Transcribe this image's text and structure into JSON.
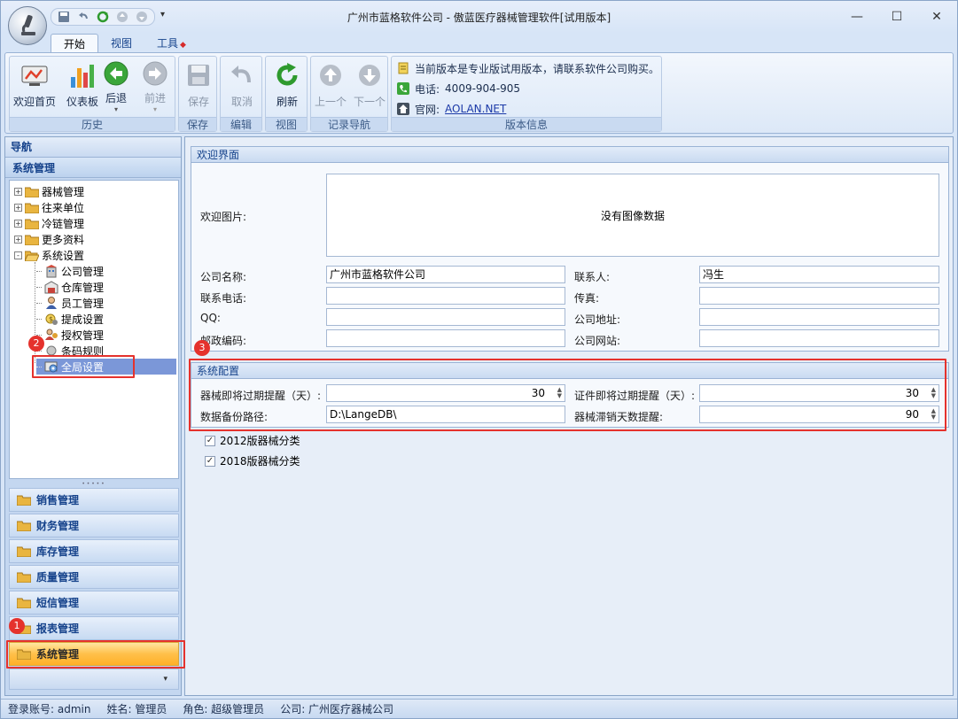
{
  "window": {
    "title": "广州市蓝格软件公司 - 傲蓝医疗器械管理软件[试用版本]"
  },
  "qat": {
    "icons": [
      "save-icon",
      "undo-icon",
      "refresh-icon",
      "up-icon",
      "down-icon"
    ],
    "dropdown": "▾"
  },
  "tabs": [
    {
      "label": "开始",
      "active": true
    },
    {
      "label": "视图",
      "active": false
    },
    {
      "label": "工具",
      "active": false,
      "mark": "◆"
    }
  ],
  "ribbon": {
    "groups": [
      {
        "label": "历史",
        "buttons": [
          {
            "label": "欢迎首页",
            "icon": "welcome-icon"
          },
          {
            "label": "仪表板",
            "icon": "dashboard-icon"
          },
          {
            "label": "后退",
            "icon": "back-icon"
          },
          {
            "label": "前进",
            "icon": "forward-icon",
            "disabled": true
          }
        ]
      },
      {
        "label": "保存",
        "buttons": [
          {
            "label": "保存",
            "icon": "save-icon",
            "disabled": true
          }
        ]
      },
      {
        "label": "编辑",
        "buttons": [
          {
            "label": "取消",
            "icon": "undo-icon",
            "disabled": true
          }
        ]
      },
      {
        "label": "视图",
        "buttons": [
          {
            "label": "刷新",
            "icon": "refresh-icon"
          }
        ]
      },
      {
        "label": "记录导航",
        "buttons": [
          {
            "label": "上一个",
            "icon": "up-icon",
            "disabled": true
          },
          {
            "label": "下一个",
            "icon": "down-icon",
            "disabled": true
          }
        ]
      },
      {
        "label": "版本信息"
      }
    ],
    "info": {
      "notice": "当前版本是专业版试用版本，请联系软件公司购买。",
      "phone_label": "电话:",
      "phone": "4009-904-905",
      "site_label": "官网:",
      "site": "AOLAN.NET"
    }
  },
  "nav": {
    "header": "导航",
    "section": "系统管理",
    "tree": [
      {
        "label": "器械管理",
        "expander": "+"
      },
      {
        "label": "往来单位",
        "expander": "+"
      },
      {
        "label": "冷链管理",
        "expander": "+"
      },
      {
        "label": "更多资料",
        "expander": "+"
      },
      {
        "label": "系统设置",
        "expander": "-"
      },
      {
        "label": "公司管理",
        "icon": "company-icon"
      },
      {
        "label": "仓库管理",
        "icon": "warehouse-icon"
      },
      {
        "label": "员工管理",
        "icon": "employee-icon"
      },
      {
        "label": "提成设置",
        "icon": "commission-icon"
      },
      {
        "label": "授权管理",
        "icon": "permission-icon"
      },
      {
        "label": "条码规则",
        "icon": "barcode-icon"
      },
      {
        "label": "全局设置",
        "icon": "settings-icon",
        "selected": true
      }
    ],
    "categories": [
      {
        "label": "销售管理"
      },
      {
        "label": "财务管理"
      },
      {
        "label": "库存管理"
      },
      {
        "label": "质量管理"
      },
      {
        "label": "短信管理"
      },
      {
        "label": "报表管理"
      },
      {
        "label": "系统管理",
        "active": true
      }
    ]
  },
  "welcome": {
    "title": "欢迎界面",
    "image_label": "欢迎图片:",
    "image_placeholder": "没有图像数据",
    "fields": {
      "company_label": "公司名称:",
      "company_value": "广州市蓝格软件公司",
      "contact_label": "联系人:",
      "contact_value": "冯生",
      "phone_label": "联系电话:",
      "phone_value": "",
      "fax_label": "传真:",
      "fax_value": "",
      "qq_label": "QQ:",
      "qq_value": "",
      "address_label": "公司地址:",
      "address_value": "",
      "zip_label": "邮政编码:",
      "zip_value": "",
      "website_label": "公司网站:",
      "website_value": ""
    }
  },
  "config": {
    "title": "系统配置",
    "device_expiry_label": "器械即将过期提醒（天）:",
    "device_expiry_value": "30",
    "cert_expiry_label": "证件即将过期提醒（天）:",
    "cert_expiry_value": "30",
    "backup_label": "数据备份路径:",
    "backup_value": "D:\\LangeDB\\",
    "unsold_label": "器械滞销天数提醒:",
    "unsold_value": "90",
    "checkboxes": [
      {
        "label": "2012版器械分类",
        "checked": true
      },
      {
        "label": "2018版器械分类",
        "checked": true
      }
    ]
  },
  "annotations": {
    "step1": "1",
    "step2": "2",
    "step3": "3"
  },
  "status": {
    "account": "登录账号: admin",
    "name": "姓名: 管理员",
    "role": "角色: 超级管理员",
    "company": "公司: 广州医疗器械公司"
  },
  "colors": {
    "accent": "#15428b",
    "annotation": "#e5322d",
    "active_category": "#ffc04a"
  }
}
